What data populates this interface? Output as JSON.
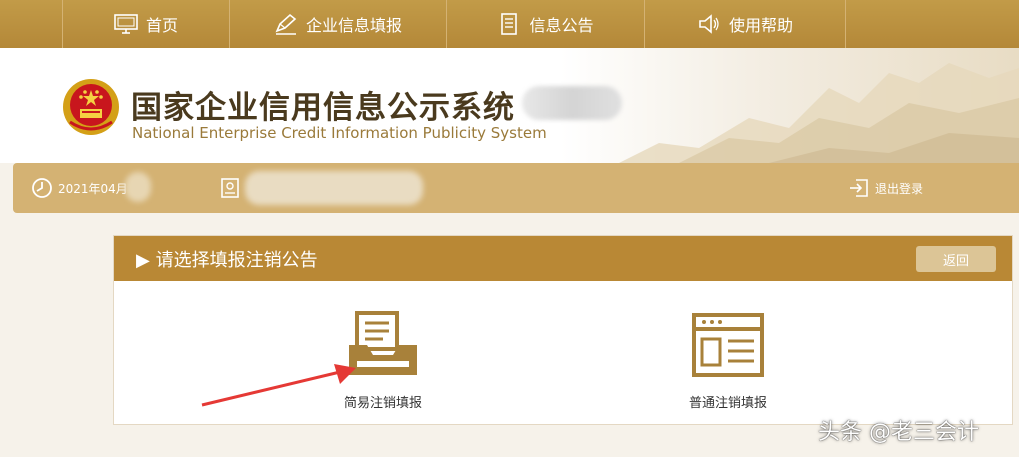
{
  "nav": {
    "items": [
      {
        "label": "首页",
        "icon": "monitor-icon"
      },
      {
        "label": "企业信息填报",
        "icon": "edit-icon"
      },
      {
        "label": "信息公告",
        "icon": "document-icon"
      },
      {
        "label": "使用帮助",
        "icon": "speaker-icon"
      }
    ]
  },
  "header": {
    "title_cn": "国家企业信用信息公示系统",
    "title_en": "National Enterprise Credit Information Publicity System"
  },
  "userbar": {
    "date": "2021年04月",
    "logout": "退出登录"
  },
  "panel": {
    "title": "▶ 请选择填报注销公告",
    "back": "返回",
    "options": [
      {
        "label": "简易注销填报",
        "icon": "inbox-tray-icon"
      },
      {
        "label": "普通注销填报",
        "icon": "form-document-icon"
      }
    ]
  },
  "watermark": "头条 @老三会计",
  "colors": {
    "nav_bg": "#b48838",
    "userbar_bg": "#d4b273",
    "panel_head_bg": "#b98835",
    "accent_gold": "#a8813a",
    "arrow_red": "#e53935"
  }
}
